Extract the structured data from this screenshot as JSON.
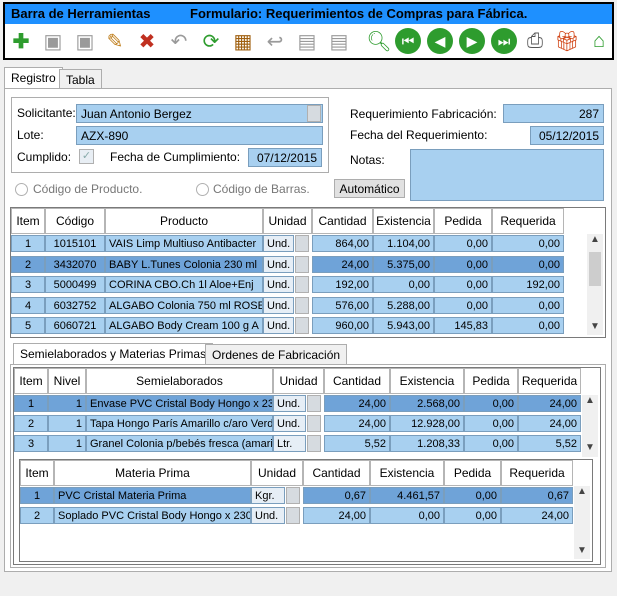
{
  "title": {
    "left": "Barra de Herramientas",
    "right": "Formulario: Requerimientos de Compras para Fábrica."
  },
  "toolbar_icons": [
    "add-icon",
    "save-icon",
    "save-disabled-icon",
    "edit-pencil-icon",
    "delete-save-icon",
    "undo-icon",
    "refresh-icon",
    "film-icon",
    "back-arrow-icon",
    "grid-disabled-icon",
    "grid-disabled-icon",
    "search-icon",
    "first-record-icon",
    "previous-record-icon",
    "next-record-icon",
    "last-record-icon",
    "print-icon",
    "gift-icon",
    "home-icon"
  ],
  "tabs": {
    "registro": "Registro",
    "tabla": "Tabla"
  },
  "form": {
    "solicitante_label": "Solicitante:",
    "solicitante_value": "Juan Antonio Bergez",
    "lote_label": "Lote:",
    "lote_value": "AZX-890",
    "cumplido_label": "Cumplido:",
    "cumplido_check": "✓",
    "fecha_cumplimiento_label": "Fecha de Cumplimiento:",
    "fecha_cumplimiento_value": "07/12/2015",
    "req_fabricacion_label": "Requerimiento Fabricación:",
    "req_fabricacion_value": "287",
    "fecha_requerimiento_label": "Fecha del Requerimiento:",
    "fecha_requerimiento_value": "05/12/2015",
    "notas_label": "Notas:",
    "codigo_producto_label": "Código de Producto.",
    "codigo_barras_label": "Código de Barras.",
    "automatico_label": "Automático"
  },
  "products": {
    "headers": [
      "Item",
      "Código",
      "Producto",
      "Unidad",
      "Cantidad",
      "Existencia",
      "Pedida",
      "Requerida"
    ],
    "rows": [
      [
        "1",
        "1015101",
        "VAIS Limp Multiuso Antibacter",
        "Und.",
        "864,00",
        "1.104,00",
        "0,00",
        "0,00"
      ],
      [
        "2",
        "3432070",
        "BABY L.Tunes Colonia 230 ml",
        "Und.",
        "24,00",
        "5.375,00",
        "0,00",
        "0,00"
      ],
      [
        "3",
        "5000499",
        "CORINA CBO.Ch 1l  Aloe+Enj",
        "Und.",
        "192,00",
        "0,00",
        "0,00",
        "192,00"
      ],
      [
        "4",
        "6032752",
        "ALGABO Colonia 750 ml ROSE",
        "Und.",
        "576,00",
        "5.288,00",
        "0,00",
        "0,00"
      ],
      [
        "5",
        "6060721",
        "ALGABO Body Cream 100 g A",
        "Und.",
        "960,00",
        "5.943,00",
        "145,83",
        "0,00"
      ]
    ]
  },
  "subtabs": {
    "semi": "Semielaborados y Materias Primas",
    "ordenes": "Ordenes de Fabricación"
  },
  "semi": {
    "headers": [
      "Item",
      "Nivel",
      "Semielaborados",
      "Unidad",
      "Cantidad",
      "Existencia",
      "Pedida",
      "Requerida"
    ],
    "rows": [
      [
        "1",
        "1",
        "Envase PVC Cristal Body Hongo x 230",
        "Und.",
        "24,00",
        "2.568,00",
        "0,00",
        "24,00"
      ],
      [
        "2",
        "1",
        "Tapa Hongo París Amarillo c/aro Verd",
        "Und.",
        "24,00",
        "12.928,00",
        "0,00",
        "24,00"
      ],
      [
        "3",
        "1",
        "Granel Colonia p/bebés fresca (amari",
        "Ltr.",
        "5,52",
        "1.208,33",
        "0,00",
        "5,52"
      ]
    ]
  },
  "materia": {
    "headers": [
      "Item",
      "Materia Prima",
      "Unidad",
      "Cantidad",
      "Existencia",
      "Pedida",
      "Requerida"
    ],
    "rows": [
      [
        "1",
        "PVC Cristal Materia Prima",
        "Kgr.",
        "0,67",
        "4.461,57",
        "0,00",
        "0,67"
      ],
      [
        "2",
        "Soplado PVC Cristal Body Hongo x 230",
        "Und.",
        "24,00",
        "0,00",
        "0,00",
        "24,00"
      ]
    ]
  }
}
